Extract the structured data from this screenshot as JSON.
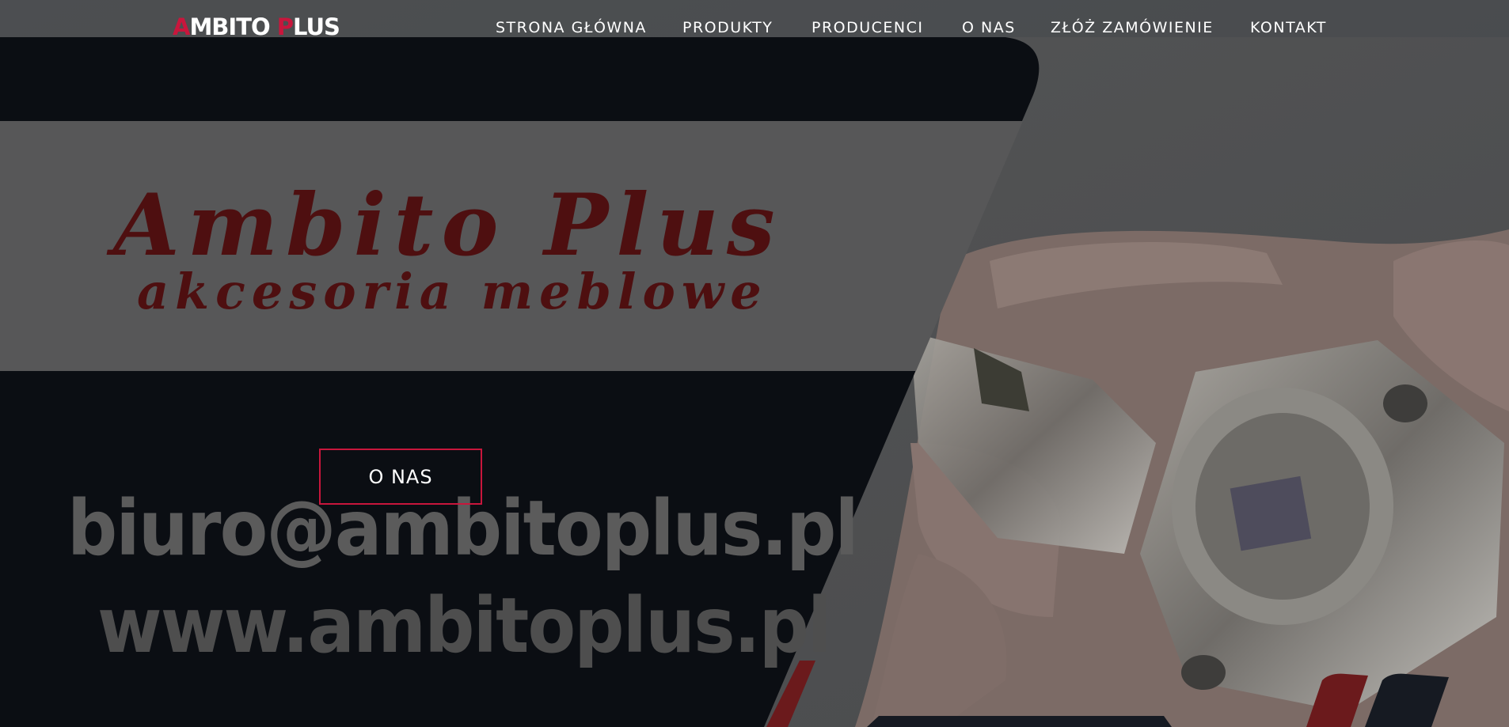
{
  "header": {
    "logo_first_letter": "A",
    "logo_middle": "MBITO ",
    "logo_second_letter": "P",
    "logo_end": "LUS",
    "nav": [
      "STRONA GŁÓWNA",
      "PRODUKTY",
      "PRODUCENCI",
      "O NAS",
      "ZŁÓŻ ZAMÓWIENIE",
      "KONTAKT"
    ]
  },
  "hero": {
    "banner_title": "Ambito Plus",
    "banner_subtitle": "akcesoria meblowe",
    "button_label": "O NAS",
    "email": "biuro@ambitoplus.pl",
    "website": "www.ambitoplus.pl",
    "photo_icon": "cabinet-hinge-photo"
  },
  "colors": {
    "accent": "#c8163c",
    "banner_text": "#4e0f10",
    "background": "#0b0e13"
  }
}
